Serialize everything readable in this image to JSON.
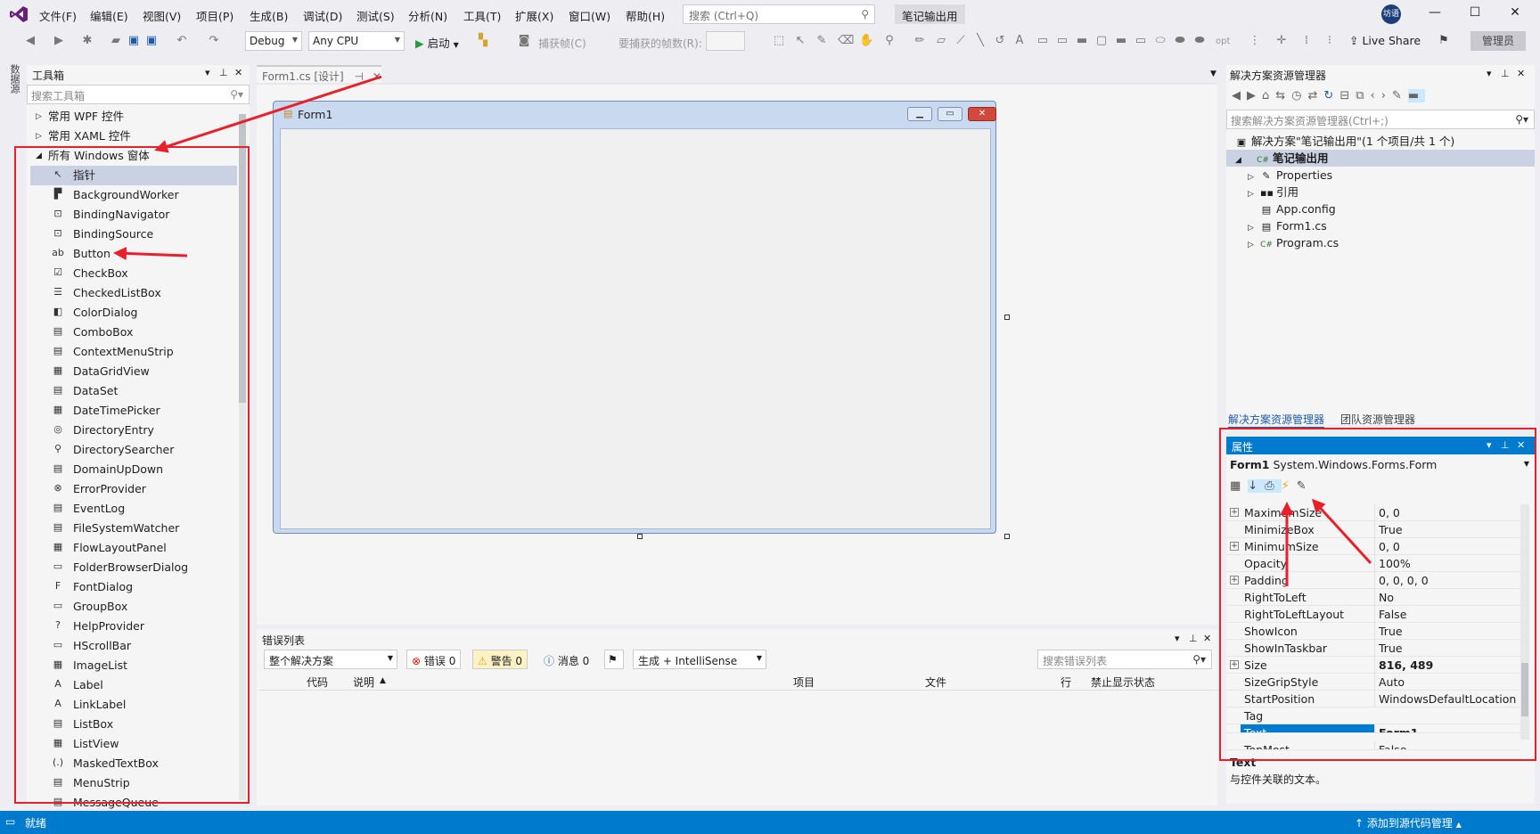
{
  "menu": {
    "file": "文件(F)",
    "edit": "编辑(E)",
    "view": "视图(V)",
    "project": "项目(P)",
    "build": "生成(B)",
    "debug": "调试(D)",
    "test": "测试(S)",
    "analyze": "分析(N)",
    "tools": "工具(T)",
    "extensions": "扩展(X)",
    "window": "窗口(W)",
    "help": "帮助(H)"
  },
  "search": {
    "placeholder": "搜索 (Ctrl+Q)"
  },
  "solution_badge": "笔记输出用",
  "avatar_text": "坊语",
  "toolbar": {
    "config": "Debug",
    "platform": "Any CPU",
    "start": "启动",
    "capture_frames": "捕获帧(C)",
    "frames_to_capture": "要捕获的帧数(R):",
    "opt": "opt",
    "live_share": "Live Share",
    "admin": "管理员"
  },
  "side_tab": "数据源",
  "toolbox": {
    "title": "工具箱",
    "search_placeholder": "搜索工具箱",
    "groups": [
      "常用 WPF 控件",
      "常用 XAML 控件",
      "所有 Windows 窗体"
    ],
    "items": [
      "指针",
      "BackgroundWorker",
      "BindingNavigator",
      "BindingSource",
      "Button",
      "CheckBox",
      "CheckedListBox",
      "ColorDialog",
      "ComboBox",
      "ContextMenuStrip",
      "DataGridView",
      "DataSet",
      "DateTimePicker",
      "DirectoryEntry",
      "DirectorySearcher",
      "DomainUpDown",
      "ErrorProvider",
      "EventLog",
      "FileSystemWatcher",
      "FlowLayoutPanel",
      "FolderBrowserDialog",
      "FontDialog",
      "GroupBox",
      "HelpProvider",
      "HScrollBar",
      "ImageList",
      "Label",
      "LinkLabel",
      "ListBox",
      "ListView",
      "MaskedTextBox",
      "MenuStrip",
      "MessageQueue"
    ]
  },
  "designer": {
    "tab_label": "Form1.cs [设计]",
    "form_title": "Form1"
  },
  "error_list": {
    "title": "错误列表",
    "scope": "整个解决方案",
    "errors": "错误 0",
    "warnings": "警告 0",
    "messages": "消息 0",
    "source": "生成 + IntelliSense",
    "search_placeholder": "搜索错误列表",
    "columns": [
      "代码",
      "说明",
      "项目",
      "文件",
      "行",
      "禁止显示状态"
    ]
  },
  "solution_explorer": {
    "title": "解决方案资源管理器",
    "search_placeholder": "搜索解决方案资源管理器(Ctrl+;)",
    "solution": "解决方案\"笔记输出用\"(1 个项目/共 1 个)",
    "project": "笔记输出用",
    "project_badge": "C#",
    "items": [
      "Properties",
      "引用",
      "App.config",
      "Form1.cs",
      "Program.cs"
    ],
    "bottom_tabs": [
      "解决方案资源管理器",
      "团队资源管理器"
    ]
  },
  "properties": {
    "title": "属性",
    "object_name": "Form1",
    "object_type": "System.Windows.Forms.Form",
    "rows": [
      {
        "name": "MaximumSize",
        "value": "0, 0",
        "expand": "⊞"
      },
      {
        "name": "MinimizeBox",
        "value": "True"
      },
      {
        "name": "MinimumSize",
        "value": "0, 0",
        "expand": "⊞"
      },
      {
        "name": "Opacity",
        "value": "100%"
      },
      {
        "name": "Padding",
        "value": "0, 0, 0, 0",
        "expand": "⊞"
      },
      {
        "name": "RightToLeft",
        "value": "No"
      },
      {
        "name": "RightToLeftLayout",
        "value": "False"
      },
      {
        "name": "ShowIcon",
        "value": "True"
      },
      {
        "name": "ShowInTaskbar",
        "value": "True"
      },
      {
        "name": "Size",
        "value": "816, 489",
        "expand": "⊞"
      },
      {
        "name": "SizeGripStyle",
        "value": "Auto"
      },
      {
        "name": "StartPosition",
        "value": "WindowsDefaultLocation"
      },
      {
        "name": "Tag",
        "value": ""
      },
      {
        "name": "Text",
        "value": "Form1"
      },
      {
        "name": "TopMost",
        "value": "False"
      }
    ],
    "desc_title": "Text",
    "desc_text": "与控件关联的文本。"
  },
  "status": {
    "ready": "就绪",
    "source_control": "添加到源代码管理"
  },
  "colors": {
    "accent": "#007acc",
    "annotation": "#e8202a"
  }
}
